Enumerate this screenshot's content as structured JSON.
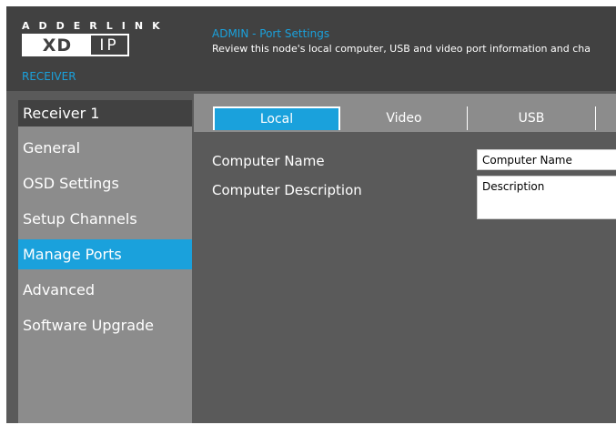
{
  "header": {
    "brand_word": "ADDERLINK",
    "logo_xd": "XD",
    "logo_ip": "IP",
    "device_role": "RECEIVER",
    "page_title": "ADMIN - Port Settings",
    "page_description": "Review this node's local computer, USB and video port information and cha"
  },
  "sidebar": {
    "device_name": "Receiver 1",
    "items": [
      {
        "label": "General"
      },
      {
        "label": "OSD Settings"
      },
      {
        "label": "Setup Channels"
      },
      {
        "label": "Manage Ports"
      },
      {
        "label": "Advanced"
      },
      {
        "label": "Software Upgrade"
      }
    ],
    "active_item": "Manage Ports"
  },
  "tabs": [
    {
      "label": "Local"
    },
    {
      "label": "Video"
    },
    {
      "label": "USB"
    }
  ],
  "active_tab": "Local",
  "form": {
    "computer_name_label": "Computer Name",
    "computer_name_value": "Computer Name",
    "computer_description_label": "Computer Description",
    "computer_description_value": "Description"
  },
  "colors": {
    "accent": "#1aa1dc",
    "background": "#5a5a5a",
    "header": "#414141",
    "sidebar": "#8c8c8c"
  }
}
